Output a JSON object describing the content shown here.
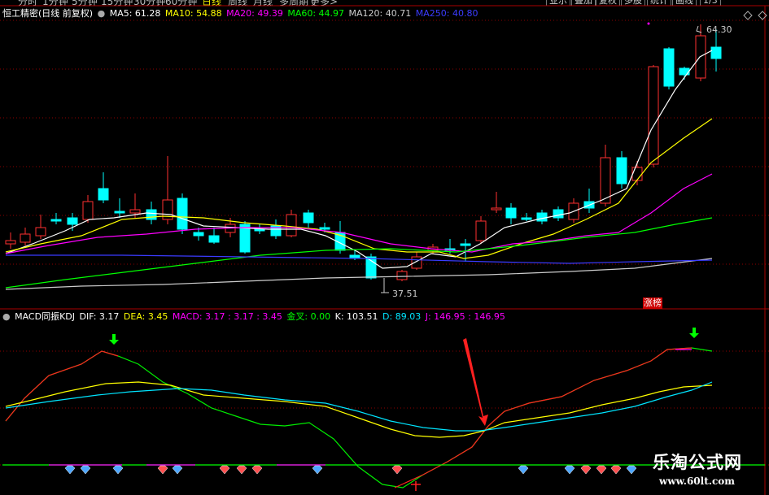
{
  "toolbar": {
    "periods": [
      "分时",
      "1分钟",
      "5分钟",
      "15分钟",
      "30分钟",
      "60分钟",
      "日线",
      "周线",
      "月线",
      "多周期",
      "更多>"
    ],
    "active_period": "日线",
    "right_buttons": [
      "业示",
      "叠加",
      "复权",
      "多股",
      "统计",
      "画线"
    ],
    "page_indicator": "1/3"
  },
  "price_chart": {
    "title": "恒工精密(日线 前复权)",
    "ma_legend": [
      {
        "label": "MA5: 61.28",
        "color": "#ffffff"
      },
      {
        "label": "MA10: 54.88",
        "color": "#ffff00"
      },
      {
        "label": "MA20: 49.39",
        "color": "#ff00ff"
      },
      {
        "label": "MA60: 44.97",
        "color": "#00ff00"
      },
      {
        "label": "MA120: 40.71",
        "color": "#cccccc"
      },
      {
        "label": "MA250: 40.80",
        "color": "#3b3bff"
      }
    ],
    "high_label": "64.30",
    "low_label": "37.51",
    "badge": "涨榜"
  },
  "indicator_chart": {
    "title": "MACD同振KDJ",
    "legend": [
      {
        "label": "DIF: 3.17",
        "color": "#ffffff"
      },
      {
        "label": "DEA: 3.45",
        "color": "#ffff00"
      },
      {
        "label": "MACD: 3.17 : 3.17 : 3.45",
        "color": "#ff00ff"
      },
      {
        "label": "金叉: 0.00",
        "color": "#00ff00"
      },
      {
        "label": "K: 103.51",
        "color": "#ffffff"
      },
      {
        "label": "D: 89.03",
        "color": "#00e5ff"
      },
      {
        "label": "J: 146.95 : 146.95",
        "color": "#ff00ff"
      }
    ]
  },
  "watermark": {
    "title": "乐淘公式网",
    "url": "www.60lt.com"
  }
}
